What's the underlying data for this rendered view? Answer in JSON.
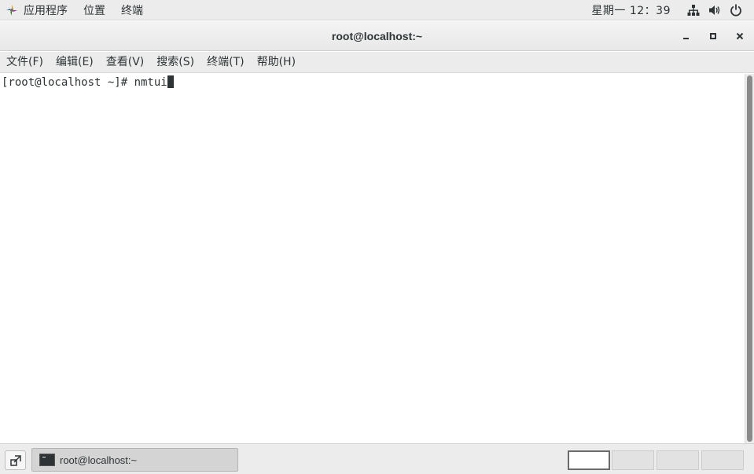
{
  "top_panel": {
    "apps_label": "应用程序",
    "places_label": "位置",
    "terminal_label": "终端",
    "clock": "星期一 12：39",
    "icons": [
      "network-icon",
      "volume-icon",
      "power-icon"
    ]
  },
  "window": {
    "title": "root@localhost:~",
    "buttons": [
      "minimize-icon",
      "maximize-icon",
      "close-icon"
    ]
  },
  "menubar": {
    "items": [
      "文件(F)",
      "编辑(E)",
      "查看(V)",
      "搜索(S)",
      "终端(T)",
      "帮助(H)"
    ]
  },
  "terminal": {
    "prompt": "[root@localhost ~]# ",
    "command": "nmtui"
  },
  "taskbar": {
    "task_label": "root@localhost:~",
    "workspaces": 4,
    "active_workspace": 1
  },
  "colors": {
    "panel_bg": "#ececec",
    "terminal_bg": "#ffffff",
    "terminal_fg": "#2e3436",
    "scroll_thumb": "#8a8a8a"
  }
}
